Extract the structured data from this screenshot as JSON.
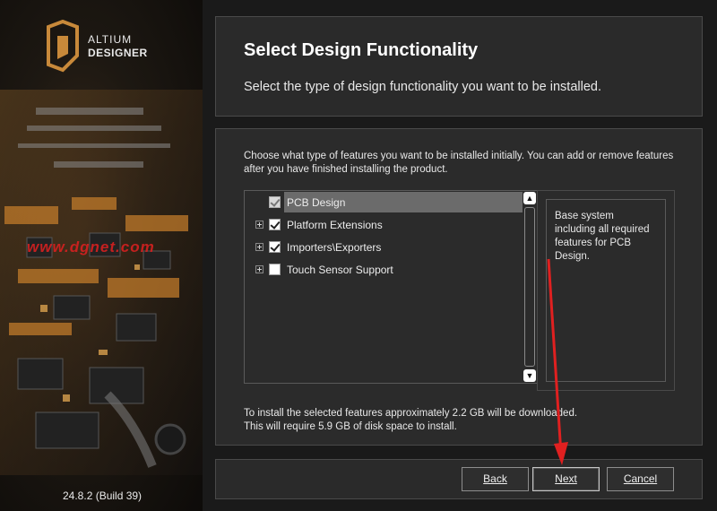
{
  "branding": {
    "brand_line1": "ALTIUM",
    "brand_line2": "DESIGNER",
    "watermark": "www.dgnet.com",
    "build": "24.8.2 (Build 39)"
  },
  "header": {
    "title": "Select Design Functionality",
    "subtitle": "Select the type of design functionality you want to be installed."
  },
  "content": {
    "description": "Choose what type of features you want to be installed initially. You can add or remove features after you have finished installing the product.",
    "features": [
      {
        "label": "PCB Design",
        "checked": true,
        "expandable": false,
        "selected": true,
        "locked": true
      },
      {
        "label": "Platform Extensions",
        "checked": true,
        "expandable": true,
        "selected": false
      },
      {
        "label": "Importers\\Exporters",
        "checked": true,
        "expandable": true,
        "selected": false
      },
      {
        "label": "Touch Sensor Support",
        "checked": false,
        "expandable": true,
        "selected": false
      }
    ],
    "info_text": "Base system including all required features for PCB Design.",
    "size_line1": "To install the selected features approximately 2.2 GB will be downloaded.",
    "size_line2": "This will require 5.9 GB of disk space to install."
  },
  "footer": {
    "back_label": "Back",
    "next_label": "Next",
    "cancel_label": "Cancel"
  },
  "colors": {
    "accent_orange": "#c8893a",
    "watermark_red": "#d62020",
    "panel_bg": "#2b2b2b",
    "arrow_red": "#e02020"
  }
}
